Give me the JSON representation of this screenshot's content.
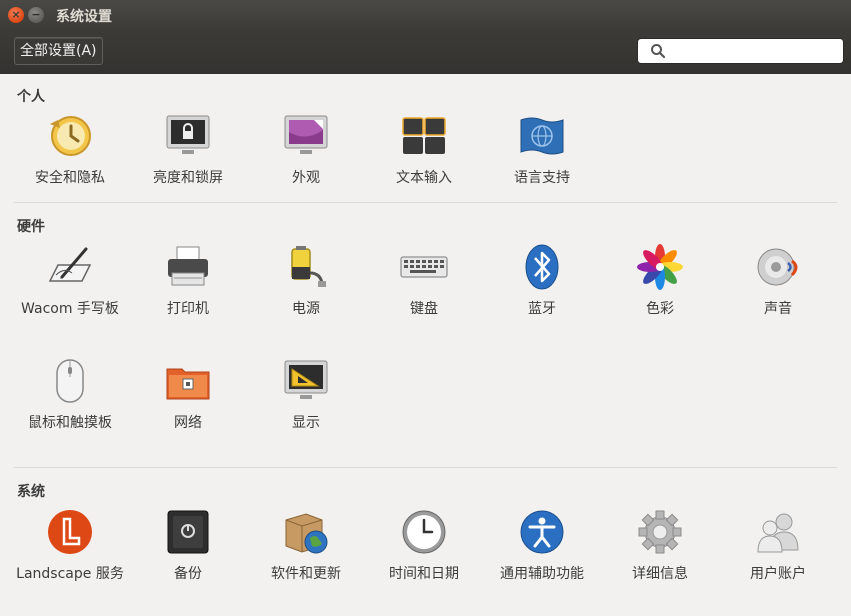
{
  "window": {
    "title": "系统设置"
  },
  "toolbar": {
    "all_settings_label": "全部设置(A)",
    "search_value": ""
  },
  "sections": {
    "personal": {
      "title": "个人",
      "items": [
        "安全和隐私",
        "亮度和锁屏",
        "外观",
        "文本输入",
        "语言支持"
      ]
    },
    "hardware": {
      "title": "硬件",
      "items": [
        "Wacom 手写板",
        "打印机",
        "电源",
        "键盘",
        "蓝牙",
        "色彩",
        "声音",
        "鼠标和触摸板",
        "网络",
        "显示"
      ]
    },
    "system": {
      "title": "系统",
      "items": [
        "Landscape 服务",
        "备份",
        "软件和更新",
        "时间和日期",
        "通用辅助功能",
        "详细信息",
        "用户账户"
      ]
    }
  },
  "icons": {
    "personal": [
      "security-privacy-icon",
      "brightness-lock-icon",
      "appearance-icon",
      "text-entry-icon",
      "language-support-icon"
    ],
    "hardware": [
      "wacom-tablet-icon",
      "printer-icon",
      "power-icon",
      "keyboard-icon",
      "bluetooth-icon",
      "color-icon",
      "sound-icon",
      "mouse-touchpad-icon",
      "network-icon",
      "display-icon"
    ],
    "system": [
      "landscape-icon",
      "backup-icon",
      "software-updates-icon",
      "time-date-icon",
      "universal-access-icon",
      "details-icon",
      "user-accounts-icon"
    ]
  },
  "colors": {
    "accent": "#dd4814",
    "titlebar": "#3c3b37",
    "background": "#f2f1f0"
  }
}
